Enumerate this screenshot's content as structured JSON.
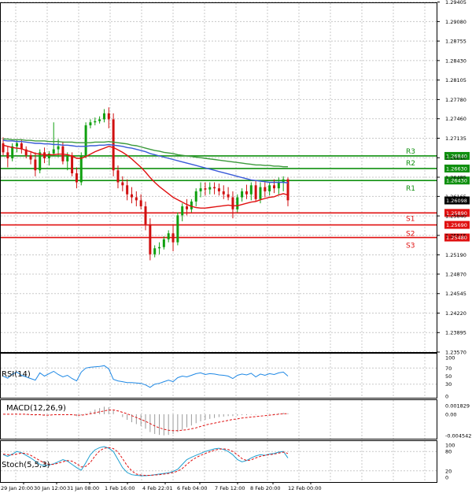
{
  "chart_data": {
    "type": "candlestick",
    "price_scale": {
      "min": 1.2357,
      "max": 1.294,
      "ticks": [
        "1.29405",
        "1.29080",
        "1.28755",
        "1.28430",
        "1.28105",
        "1.27780",
        "1.27460",
        "1.27135",
        "1.26810",
        "1.26485",
        "1.26165",
        "1.25840",
        "1.25515",
        "1.25190",
        "1.24870",
        "1.24545",
        "1.24220",
        "1.23895",
        "1.23570"
      ]
    },
    "last_price": "1.26098",
    "x_labels": [
      "29 Jan 20:00",
      "30 Jan 12:00",
      "31 Jan 08:00",
      "1 Feb 16:00",
      "4 Feb 22:01",
      "6 Feb 04:00",
      "7 Feb 12:00",
      "8 Feb 20:00",
      "12 Feb 00:00"
    ],
    "levels": [
      {
        "name": "R3",
        "value": 1.2684,
        "label": "1.26840",
        "color": "#109010"
      },
      {
        "name": "R2",
        "value": 1.2663,
        "label": "1.26630",
        "color": "#109010"
      },
      {
        "name": "R1",
        "value": 1.2643,
        "label": "1.26430",
        "color": "#109010"
      },
      {
        "name": "S1",
        "value": 1.2589,
        "label": "1.25890",
        "color": "#e01010"
      },
      {
        "name": "S2",
        "value": 1.2569,
        "label": "1.25690",
        "color": "#e01010"
      },
      {
        "name": "S3",
        "value": 1.2548,
        "label": "1.25480",
        "color": "#e01010"
      }
    ],
    "candles": [
      [
        1.2705,
        1.2715,
        1.2685,
        1.269
      ],
      [
        1.269,
        1.27,
        1.2665,
        1.268
      ],
      [
        1.268,
        1.2705,
        1.2675,
        1.27
      ],
      [
        1.27,
        1.271,
        1.269,
        1.2705
      ],
      [
        1.2705,
        1.2712,
        1.2688,
        1.2695
      ],
      [
        1.2695,
        1.27,
        1.268,
        1.2685
      ],
      [
        1.2685,
        1.269,
        1.267,
        1.2678
      ],
      [
        1.2678,
        1.269,
        1.265,
        1.266
      ],
      [
        1.266,
        1.2695,
        1.2655,
        1.269
      ],
      [
        1.269,
        1.2698,
        1.2672,
        1.268
      ],
      [
        1.268,
        1.2692,
        1.2668,
        1.2688
      ],
      [
        1.2688,
        1.274,
        1.2685,
        1.2695
      ],
      [
        1.2695,
        1.2712,
        1.2682,
        1.27
      ],
      [
        1.27,
        1.2708,
        1.267,
        1.2675
      ],
      [
        1.2675,
        1.269,
        1.266,
        1.2685
      ],
      [
        1.2685,
        1.269,
        1.265,
        1.2655
      ],
      [
        1.2655,
        1.2665,
        1.263,
        1.264
      ],
      [
        1.264,
        1.269,
        1.2635,
        1.2685
      ],
      [
        1.2685,
        1.274,
        1.268,
        1.2735
      ],
      [
        1.2735,
        1.2745,
        1.273,
        1.274
      ],
      [
        1.274,
        1.2748,
        1.2735,
        1.2742
      ],
      [
        1.2742,
        1.275,
        1.2738,
        1.2745
      ],
      [
        1.2745,
        1.2762,
        1.274,
        1.2755
      ],
      [
        1.2755,
        1.2765,
        1.273,
        1.2745
      ],
      [
        1.2745,
        1.2755,
        1.265,
        1.266
      ],
      [
        1.266,
        1.2668,
        1.263,
        1.264
      ],
      [
        1.264,
        1.265,
        1.2625,
        1.2635
      ],
      [
        1.2635,
        1.2645,
        1.261,
        1.262
      ],
      [
        1.262,
        1.2632,
        1.2605,
        1.2615
      ],
      [
        1.2615,
        1.2625,
        1.26,
        1.261
      ],
      [
        1.261,
        1.262,
        1.2595,
        1.26
      ],
      [
        1.26,
        1.2608,
        1.256,
        1.257
      ],
      [
        1.257,
        1.258,
        1.251,
        1.252
      ],
      [
        1.252,
        1.2535,
        1.2515,
        1.253
      ],
      [
        1.253,
        1.254,
        1.252,
        1.2532
      ],
      [
        1.2532,
        1.255,
        1.2528,
        1.2545
      ],
      [
        1.2545,
        1.256,
        1.254,
        1.2555
      ],
      [
        1.2555,
        1.257,
        1.2525,
        1.254
      ],
      [
        1.254,
        1.259,
        1.2535,
        1.2585
      ],
      [
        1.2585,
        1.2605,
        1.2575,
        1.26
      ],
      [
        1.26,
        1.2612,
        1.2585,
        1.2595
      ],
      [
        1.2595,
        1.2612,
        1.259,
        1.2608
      ],
      [
        1.2608,
        1.263,
        1.26,
        1.2625
      ],
      [
        1.2625,
        1.264,
        1.2615,
        1.263
      ],
      [
        1.263,
        1.264,
        1.2618,
        1.2628
      ],
      [
        1.2628,
        1.264,
        1.262,
        1.2632
      ],
      [
        1.2632,
        1.264,
        1.262,
        1.263
      ],
      [
        1.263,
        1.2638,
        1.2618,
        1.2625
      ],
      [
        1.2625,
        1.2635,
        1.2612,
        1.262
      ],
      [
        1.262,
        1.2632,
        1.261,
        1.2615
      ],
      [
        1.2615,
        1.2625,
        1.258,
        1.2595
      ],
      [
        1.2595,
        1.262,
        1.259,
        1.2615
      ],
      [
        1.2615,
        1.263,
        1.2608,
        1.2625
      ],
      [
        1.2625,
        1.2636,
        1.2612,
        1.262
      ],
      [
        1.262,
        1.264,
        1.261,
        1.2635
      ],
      [
        1.2635,
        1.2642,
        1.2608,
        1.2612
      ],
      [
        1.2612,
        1.264,
        1.2605,
        1.2632
      ],
      [
        1.2632,
        1.264,
        1.2615,
        1.2625
      ],
      [
        1.2625,
        1.264,
        1.2618,
        1.2635
      ],
      [
        1.2635,
        1.2645,
        1.2622,
        1.263
      ],
      [
        1.263,
        1.2648,
        1.262,
        1.264
      ],
      [
        1.264,
        1.265,
        1.2625,
        1.2645
      ],
      [
        1.2645,
        1.2648,
        1.26,
        1.261
      ]
    ],
    "ma_lines": [
      {
        "name": "",
        "color": "#e01010",
        "values": [
          1.2702,
          1.27,
          1.2698,
          1.2697,
          1.2696,
          1.2693,
          1.2691,
          1.2688,
          1.2687,
          1.2686,
          1.2686,
          1.2686,
          1.2687,
          1.2687,
          1.2686,
          1.2684,
          1.268,
          1.268,
          1.2683,
          1.2687,
          1.2691,
          1.2694,
          1.2697,
          1.27,
          1.2698,
          1.2694,
          1.269,
          1.2685,
          1.2679,
          1.2672,
          1.2665,
          1.2657,
          1.2648,
          1.264,
          1.2633,
          1.2627,
          1.2621,
          1.2615,
          1.2611,
          1.2607,
          1.2603,
          1.26,
          1.2598,
          1.2597,
          1.2597,
          1.2598,
          1.2599,
          1.26,
          1.2601,
          1.2602,
          1.2601,
          1.2601,
          1.2603,
          1.2605,
          1.2607,
          1.2608,
          1.2611,
          1.2613,
          1.2615,
          1.2616,
          1.2619,
          1.2621,
          1.2619
        ]
      },
      {
        "name": "",
        "color": "#3a5bd8",
        "values": [
          1.271,
          1.2709,
          1.2709,
          1.2708,
          1.2708,
          1.2707,
          1.2706,
          1.2705,
          1.2705,
          1.2704,
          1.2704,
          1.2703,
          1.2703,
          1.2702,
          1.2702,
          1.2701,
          1.27,
          1.27,
          1.27,
          1.2701,
          1.2701,
          1.2702,
          1.2702,
          1.2703,
          1.2702,
          1.2701,
          1.27,
          1.2698,
          1.2697,
          1.2695,
          1.2693,
          1.2691,
          1.2688,
          1.2686,
          1.2684,
          1.2682,
          1.268,
          1.2678,
          1.2676,
          1.2674,
          1.2672,
          1.267,
          1.2668,
          1.2666,
          1.2664,
          1.2662,
          1.266,
          1.2658,
          1.2656,
          1.2654,
          1.2652,
          1.265,
          1.2648,
          1.2646,
          1.2644,
          1.2643,
          1.2642,
          1.2641,
          1.264,
          1.264,
          1.264,
          1.264,
          1.2639
        ]
      },
      {
        "name": "",
        "color": "#3c9a3c",
        "values": [
          1.2712,
          1.2712,
          1.2711,
          1.2711,
          1.2711,
          1.271,
          1.271,
          1.2709,
          1.2709,
          1.2709,
          1.2708,
          1.2708,
          1.2708,
          1.2707,
          1.2707,
          1.2707,
          1.2706,
          1.2706,
          1.2706,
          1.2706,
          1.2707,
          1.2707,
          1.2707,
          1.2708,
          1.2707,
          1.2706,
          1.2705,
          1.2704,
          1.2702,
          1.2701,
          1.2699,
          1.2697,
          1.2695,
          1.2693,
          1.2692,
          1.269,
          1.2689,
          1.2688,
          1.2686,
          1.2685,
          1.2684,
          1.2683,
          1.2682,
          1.2681,
          1.268,
          1.2679,
          1.2678,
          1.2677,
          1.2676,
          1.2675,
          1.2674,
          1.2673,
          1.2672,
          1.2671,
          1.267,
          1.2669,
          1.2669,
          1.2668,
          1.2668,
          1.2667,
          1.2667,
          1.2666,
          1.2666
        ]
      }
    ],
    "rsi": {
      "label": "RSI(14)",
      "ticks": [
        "100",
        "70",
        "50",
        "30",
        "0"
      ],
      "values": [
        50,
        45,
        55,
        60,
        52,
        48,
        44,
        40,
        58,
        50,
        56,
        62,
        54,
        48,
        52,
        44,
        38,
        60,
        70,
        72,
        73,
        74,
        76,
        68,
        42,
        38,
        36,
        34,
        34,
        33,
        32,
        28,
        22,
        30,
        32,
        36,
        40,
        36,
        46,
        50,
        48,
        52,
        56,
        58,
        54,
        56,
        55,
        53,
        52,
        50,
        44,
        52,
        55,
        53,
        57,
        48,
        55,
        52,
        56,
        54,
        58,
        60,
        50
      ]
    },
    "macd": {
      "label": "MACD(12,26,9)",
      "ticks": [
        "0.001829",
        "0.00",
        "-0.004542"
      ],
      "hist": [
        0.0,
        -0.0001,
        0.0,
        0.0001,
        0.0,
        -0.0001,
        -0.0002,
        -0.0003,
        -0.0002,
        -0.0002,
        -0.0001,
        0.0,
        0.0,
        -0.0001,
        -0.0001,
        -0.0002,
        -0.0004,
        -0.0002,
        0.0002,
        0.0006,
        0.001,
        0.0013,
        0.0016,
        0.0015,
        0.0008,
        0.0,
        -0.0006,
        -0.0012,
        -0.0017,
        -0.0021,
        -0.0025,
        -0.0031,
        -0.0038,
        -0.0042,
        -0.0044,
        -0.0045,
        -0.0044,
        -0.0042,
        -0.0038,
        -0.0033,
        -0.0028,
        -0.0024,
        -0.0019,
        -0.0015,
        -0.0012,
        -0.001,
        -0.0008,
        -0.0006,
        -0.0005,
        -0.0004,
        -0.0004,
        -0.0003,
        -0.0002,
        -0.0002,
        -0.0001,
        -0.0001,
        0.0,
        0.0,
        0.0001,
        0.0001,
        0.0002,
        0.0003,
        0.0002
      ],
      "signal": [
        0.0,
        0.0,
        0.0,
        0.0,
        0.0,
        0.0,
        -0.0001,
        -0.0001,
        -0.0001,
        -0.0002,
        -0.0002,
        -0.0001,
        -0.0001,
        -0.0001,
        -0.0001,
        -0.0001,
        -0.0002,
        -0.0002,
        -0.0001,
        0.0001,
        0.0003,
        0.0005,
        0.0007,
        0.0009,
        0.0009,
        0.0007,
        0.0004,
        0.0001,
        -0.0003,
        -0.0007,
        -0.0011,
        -0.0015,
        -0.002,
        -0.0025,
        -0.0029,
        -0.0032,
        -0.0034,
        -0.0035,
        -0.0035,
        -0.0034,
        -0.0033,
        -0.0031,
        -0.0029,
        -0.0026,
        -0.0023,
        -0.0021,
        -0.0019,
        -0.0017,
        -0.0015,
        -0.0013,
        -0.0011,
        -0.001,
        -0.0008,
        -0.0007,
        -0.0006,
        -0.0005,
        -0.0004,
        -0.0003,
        -0.0002,
        -0.0001,
        0.0,
        0.0001,
        0.0001
      ]
    },
    "stoch": {
      "label": "Stoch(5,5,3)",
      "ticks": [
        "100",
        "80",
        "20",
        "0"
      ],
      "k": [
        70,
        65,
        72,
        80,
        76,
        68,
        60,
        50,
        40,
        36,
        38,
        42,
        48,
        55,
        50,
        40,
        30,
        22,
        45,
        70,
        85,
        92,
        95,
        90,
        80,
        55,
        30,
        15,
        8,
        6,
        5,
        5,
        6,
        8,
        10,
        12,
        14,
        18,
        25,
        40,
        55,
        62,
        68,
        74,
        80,
        84,
        88,
        90,
        86,
        80,
        70,
        55,
        48,
        52,
        60,
        66,
        70,
        68,
        72,
        74,
        78,
        80,
        60
      ],
      "d": [
        72,
        70,
        70,
        72,
        75,
        74,
        68,
        60,
        52,
        44,
        40,
        40,
        44,
        48,
        52,
        50,
        42,
        32,
        34,
        46,
        66,
        82,
        90,
        92,
        89,
        78,
        58,
        36,
        20,
        10,
        7,
        6,
        6,
        7,
        8,
        10,
        12,
        15,
        19,
        27,
        40,
        52,
        61,
        68,
        74,
        79,
        84,
        87,
        88,
        86,
        80,
        70,
        58,
        52,
        54,
        60,
        65,
        68,
        70,
        72,
        75,
        78,
        74
      ]
    }
  }
}
